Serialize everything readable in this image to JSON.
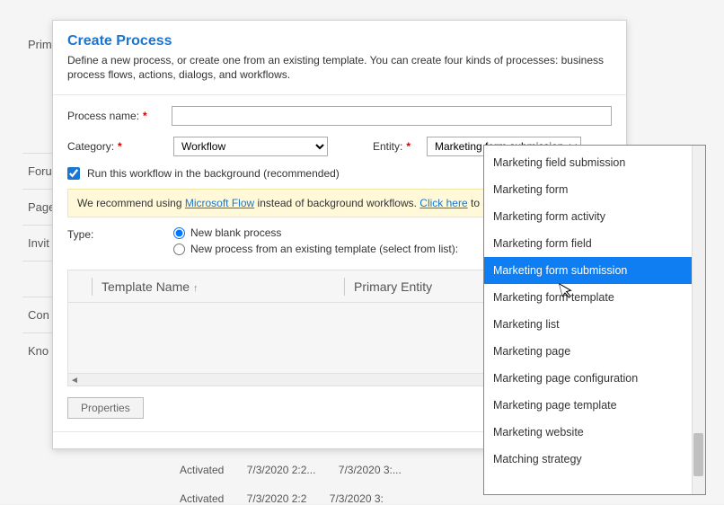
{
  "bg": {
    "sidebar": [
      "Prim",
      "Foru",
      "Page",
      "Invit",
      "",
      "Con",
      "Kno"
    ],
    "row1_status": "Activated",
    "row1_t1": "7/3/2020 2:2...",
    "row1_t2": "7/3/2020 3:...",
    "row2_status": "Activated",
    "row2_t1": "7/3/2020 2:2",
    "row2_t2": "7/3/2020 3:"
  },
  "dialog": {
    "title": "Create Process",
    "subtitle": "Define a new process, or create one from an existing template. You can create four kinds of processes: business process flows, actions, dialogs, and workflows.",
    "process_name_label": "Process name:",
    "process_name_value": "",
    "category_label": "Category:",
    "category_value": "Workflow",
    "entity_label": "Entity:",
    "entity_value": "Marketing form submission",
    "background_label": "Run this workflow in the background (recommended)",
    "info_prefix": "We recommend using ",
    "info_link1": "Microsoft Flow",
    "info_mid": " instead of background workflows. ",
    "info_link2": "Click here",
    "info_suffix": " to sta",
    "type_label": "Type:",
    "radio_blank": "New blank process",
    "radio_template": "New process from an existing template (select from list):",
    "col_name": "Template Name",
    "col_entity": "Primary Entity",
    "properties_btn": "Properties"
  },
  "dropdown": {
    "items": [
      "Marketing field submission",
      "Marketing form",
      "Marketing form activity",
      "Marketing form field",
      "Marketing form submission",
      "Marketing form template",
      "Marketing list",
      "Marketing page",
      "Marketing page configuration",
      "Marketing page template",
      "Marketing website",
      "Matching strategy"
    ],
    "selected_index": 4
  }
}
